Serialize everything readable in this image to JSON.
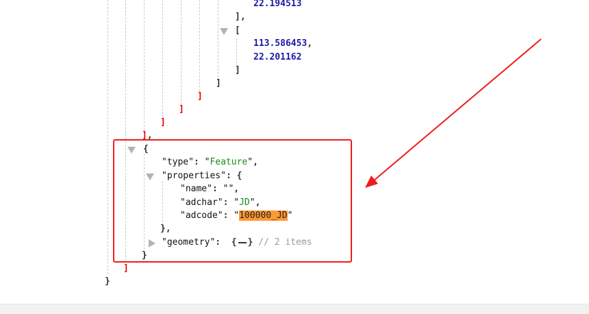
{
  "json": {
    "numbers": [
      "22.194513",
      "113.586453",
      "22.201162"
    ],
    "open_bracket": "[",
    "close_bracket": "]",
    "close_bracket_comma": "],",
    "open_brace": "{",
    "close_brace": "}",
    "close_brace_comma": "},",
    "comma": ",",
    "colon": ":",
    "feature": {
      "type_key": "type",
      "type_value": "Feature",
      "properties_key": "properties",
      "name_key": "name",
      "name_value": "",
      "adchar_key": "adchar",
      "adchar_value": "JD",
      "adcode_key": "adcode",
      "adcode_value": "100000_JD",
      "geometry_key": "geometry",
      "geometry_comment": "// 2 items"
    }
  },
  "annotation": {
    "box_color": "#ee1c1c",
    "arrow_color": "#ee1c1c"
  },
  "icons": {
    "expanded": "triangle-down-icon",
    "collapsed": "triangle-right-icon",
    "ellipsis": "ellipsis-icon"
  }
}
